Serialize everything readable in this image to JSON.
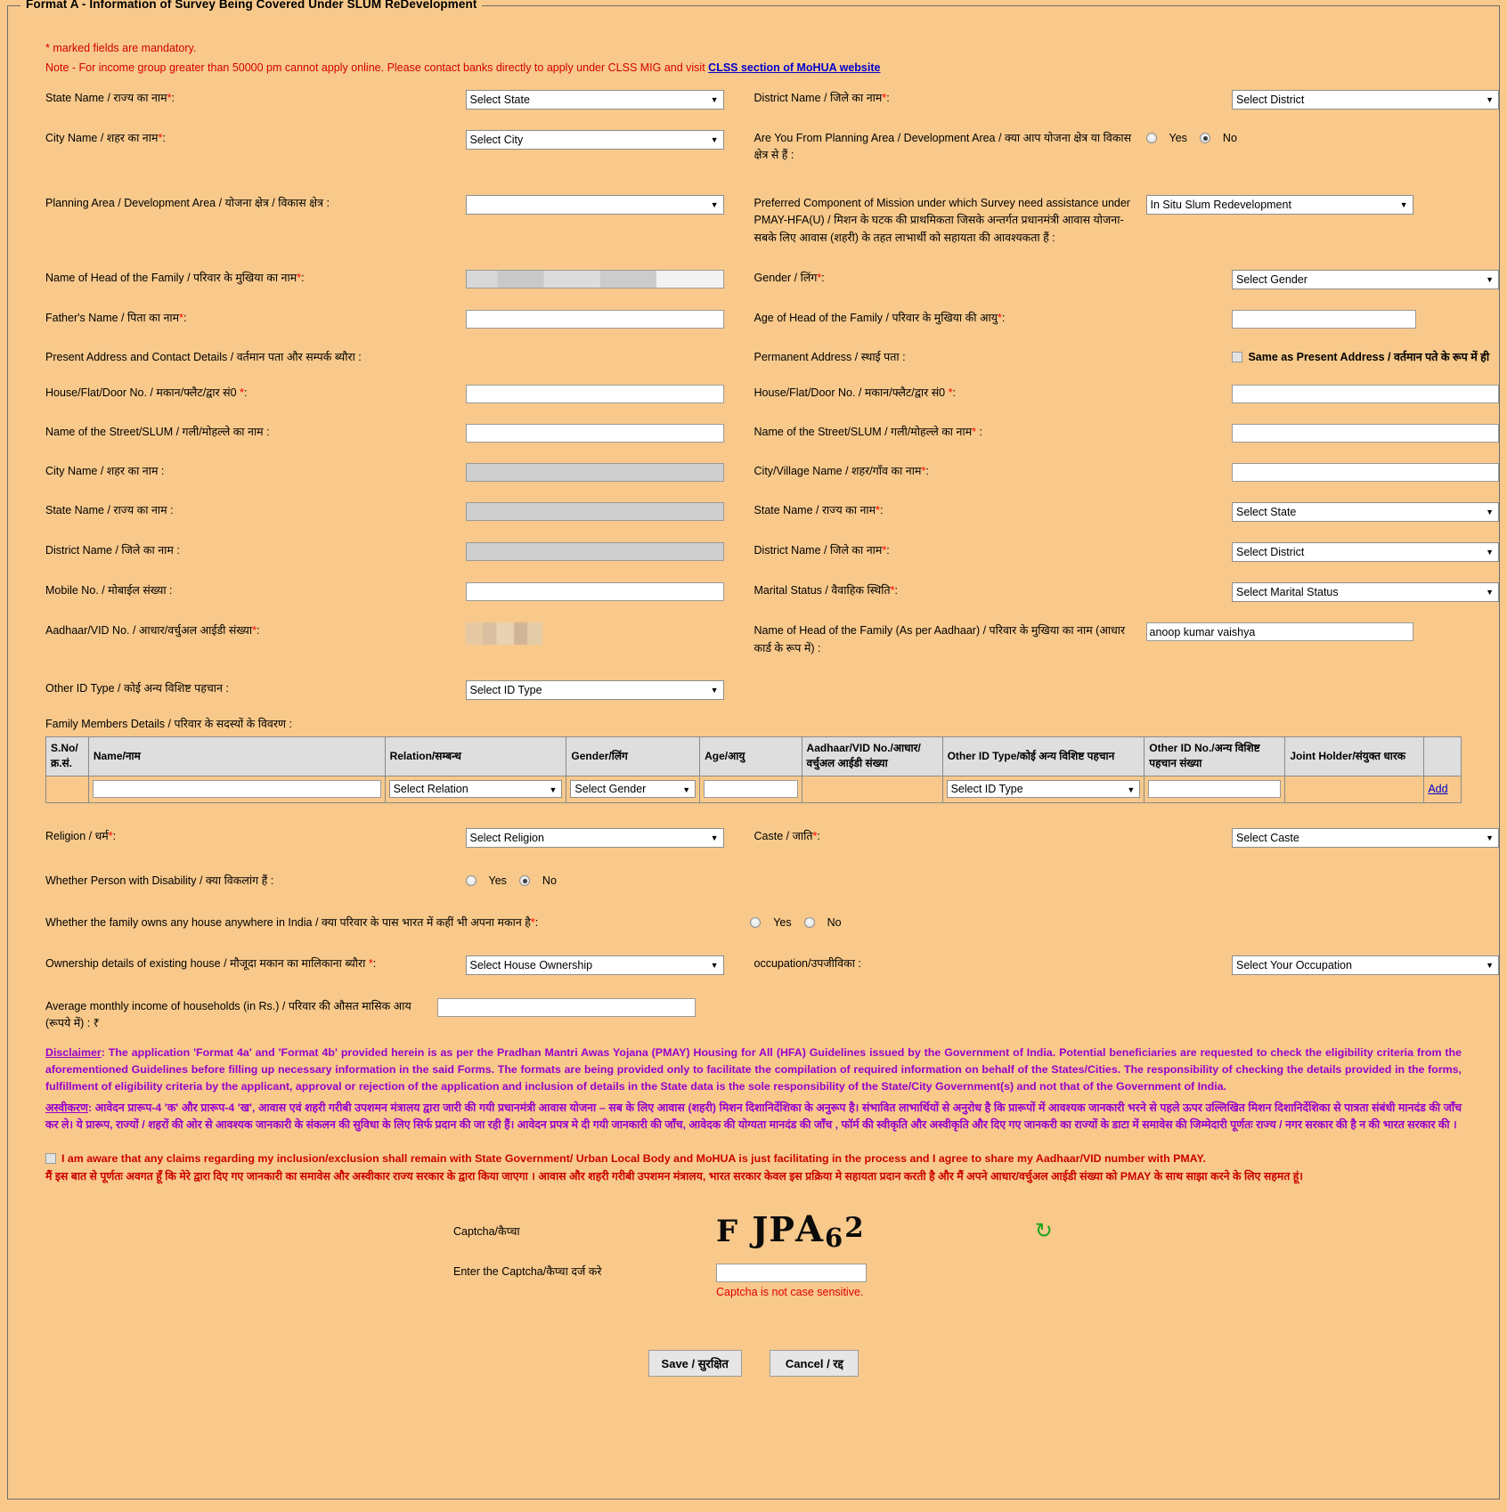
{
  "form": {
    "legend": "Format A - Information of Survey Being Covered Under SLUM ReDevelopment",
    "mandatory_note": "* marked fields are mandatory.",
    "income_note": "Note - For income group greater than 50000 pm cannot apply online. Please contact banks directly to apply under CLSS MIG and visit",
    "income_note_link": "CLSS section of MoHUA website"
  },
  "fields": {
    "state_name": {
      "label": "State Name / राज्य का नाम",
      "value": "Select State"
    },
    "district_name": {
      "label": "District Name / जिले का नाम",
      "value": "Select District"
    },
    "city_name": {
      "label": "City Name / शहर का नाम",
      "value": "Select City"
    },
    "planning_area_question": {
      "label": "Are You From Planning Area / Development Area / क्या आप योजना क्षेत्र या विकास क्षेत्र से हैं :",
      "yes": "Yes",
      "no": "No",
      "selected": "No"
    },
    "planning_area": {
      "label": "Planning Area / Development Area / योजना क्षेत्र / विकास क्षेत्र :",
      "value": ""
    },
    "preferred_component": {
      "label": "Preferred Component of Mission under which Survey need assistance under PMAY-HFA(U) / मिशन के घटक की प्राथमिकता जिसके अन्तर्गत प्रधानमंत्री आवास योजना-सबके लिए आवास (शहरी) के तहत लाभार्थी को सहायता की आवश्यकता हैं :",
      "value": "In Situ Slum Redevelopment"
    },
    "head_of_family": {
      "label": "Name of Head of the Family / परिवार के मुखिया का नाम",
      "value": ""
    },
    "gender": {
      "label": "Gender / लिंग",
      "value": "Select Gender"
    },
    "father_name": {
      "label": "Father's Name / पिता का नाम",
      "value": ""
    },
    "age_head": {
      "label": "Age of Head of the Family / परिवार के मुखिया की आयु",
      "value": ""
    },
    "present_address_heading": {
      "label": "Present Address and Contact Details / वर्तमान पता और सम्पर्क ब्यौरा :"
    },
    "permanent_address_heading": {
      "label": "Permanent Address / स्थाई पता :"
    },
    "same_as_present": {
      "label": "Same as Present Address / वर्तमान पते के रूप में ही",
      "checked": false
    },
    "p_house_no": {
      "label": "House/Flat/Door No. / मकान/फ्लैट/द्वार सं0",
      "value": ""
    },
    "perm_house_no": {
      "label": "House/Flat/Door No. / मकान/फ्लैट/द्वार सं0",
      "value": ""
    },
    "p_street": {
      "label": "Name of the Street/SLUM / गली/मोहल्ले का नाम :",
      "value": ""
    },
    "perm_street": {
      "label": "Name of the Street/SLUM / गली/मोहल्ले का नाम",
      "value": ""
    },
    "p_city": {
      "label": "City Name / शहर का नाम :",
      "value": ""
    },
    "perm_city_village": {
      "label": "City/Village Name / शहर/गाँव का नाम",
      "value": ""
    },
    "p_state": {
      "label": "State Name / राज्य का नाम :",
      "value": ""
    },
    "perm_state": {
      "label": "State Name / राज्य का नाम",
      "value": "Select State"
    },
    "p_district": {
      "label": "District Name / जिले का नाम :",
      "value": ""
    },
    "perm_district": {
      "label": "District Name / जिले का नाम",
      "value": "Select District"
    },
    "mobile_no": {
      "label": "Mobile No. / मोबाईल संख्या :",
      "value": ""
    },
    "marital_status": {
      "label": "Marital Status / वैवाहिक स्थिति",
      "value": "Select Marital Status"
    },
    "aadhaar_no": {
      "label": "Aadhaar/VID No. / आधार/वर्चुअल आईडी संख्या",
      "value": ""
    },
    "head_as_per_aadhaar": {
      "label": "Name of Head of the Family (As per Aadhaar) / परिवार के मुखिया का नाम (आधार कार्ड के रूप में) :",
      "value": "anoop kumar vaishya"
    },
    "other_id_type": {
      "label": "Other ID Type / कोई अन्य विशिष्ट पहचान :",
      "value": "Select ID Type"
    },
    "religion": {
      "label": "Religion / धर्म",
      "value": "Select Religion"
    },
    "caste": {
      "label": "Caste / जाति",
      "value": "Select Caste"
    },
    "disability": {
      "label": "Whether Person with Disability / क्या विकलांग हैं :",
      "yes": "Yes",
      "no": "No",
      "selected": "No"
    },
    "owns_house": {
      "label": "Whether the family owns any house anywhere in India / क्या परिवार के पास भारत में कहीं भी अपना मकान है",
      "yes": "Yes",
      "no": "No",
      "selected": ""
    },
    "ownership_details": {
      "label": "Ownership details of existing house / मौजूदा मकान का मालिकाना ब्यौरा",
      "value": "Select House Ownership"
    },
    "occupation": {
      "label": "occupation/उपजीविका  :",
      "value": "Select Your Occupation"
    },
    "avg_income": {
      "label": "Average monthly income of households (in Rs.) / परिवार की औसत मासिक आय (रूपये में) : ₹",
      "value": ""
    }
  },
  "family_table": {
    "heading": "Family Members Details / परिवार के सदस्यों के विवरण :",
    "columns": [
      "S.No/ क्र.सं.",
      "Name/नाम",
      "Relation/सम्बन्ध",
      "Gender/लिंग",
      "Age/आयु",
      "Aadhaar/VID No./आधार/ वर्चुअल आईडी संख्या",
      "Other ID Type/कोई अन्य विशिष्ट पहचान",
      "Other ID No./अन्य विशिष्ट पहचान संख्या",
      "Joint Holder/संयुक्त धारक"
    ],
    "row": {
      "sno": "",
      "name": "",
      "relation": "Select Relation",
      "gender": "Select Gender",
      "age": "",
      "aadhaar": "",
      "other_id_type": "Select ID Type",
      "other_id_no": "",
      "joint_holder": "",
      "add_label": "Add"
    }
  },
  "disclaimer": {
    "title": "Disclaimer",
    "en": ": The application 'Format 4a' and 'Format 4b' provided herein is as per the Pradhan Mantri Awas Yojana (PMAY) Housing for All (HFA) Guidelines issued by the Government of India. Potential beneficiaries are requested to check the eligibility criteria from the aforementioned Guidelines before filling up necessary information in the said Forms. The formats are being provided only to facilitate the compilation of required information on behalf of the States/Cities. The responsibility of checking the details provided in the forms, fulfillment of eligibility criteria by the applicant, approval or rejection of the application and inclusion of details in the State data is the sole responsibility of the State/City Government(s) and not that of the Government of India.",
    "hi_title": "अस्वीकरण",
    "hi": ": आवेदन प्रारूप-4 'क' और प्रारूप-4 'ख', आवास एवं शहरी गरीबी उपशमन मंत्रालय द्वारा जारी की गयी प्रधानमंत्री आवास योजना – सब के लिए आवास (शहरी) मिशन दिशानिर्देशिका के अनुरूप है। संभावित लाभार्थियों से अनुरोध है कि प्रारूपों में आवश्यक जानकारी भरने से पहले ऊपर उल्लिखित मिशन दिशानिर्देशिका से पात्रता संबंधी मानदंड की जाँच कर ले। ये प्रारूप, राज्यों / शहरों की ओर से आवश्यक जानकारी के संकलन की सुविधा के लिए सिर्फ प्रदान की जा रही हैं। आवेदन प्रपत्र मे दी गयी जानकारी की जाँच, आवेदक की योग्यता मानदंड की जाँच , फॉर्म की स्वीकृति और अस्वीकृति और दिए गए जानकरी का राज्यों के डाटा में समावेस की जिम्मेदारी पूर्णतः राज्य / नगर सरकार की है न की भारत सरकार की ।"
  },
  "consent": {
    "checked": false,
    "en": "I am aware that any claims regarding my inclusion/exclusion shall remain with State Government/ Urban Local Body and MoHUA is just facilitating in the process and I agree to share my Aadhaar/VID number with PMAY.",
    "hi": "मैं इस बात से पूर्णतः अवगत हूँ कि मेरे द्वारा दिए गए जानकारी का समावेस और अस्वीकार राज्य सरकार के द्वारा किया जाएगा । आवास और शहरी गरीबी उपशमन मंत्रालय, भारत सरकार केवल इस प्रक्रिया मे सहायता प्रदान करती है और मैं अपने आधार/वर्चुअल आईडी संख्या को PMAY के साथ साझा करने के लिए सहमत हूं।"
  },
  "captcha": {
    "label": "Captcha/कैप्चा",
    "code": "FJPA62",
    "enter_label": "Enter the Captcha/कैप्चा दर्ज करे",
    "value": "",
    "note": "Captcha is not case sensitive.",
    "refresh_icon": "refresh-icon"
  },
  "buttons": {
    "save": "Save / सुरक्षित",
    "cancel": "Cancel / रद्द"
  },
  "colors": {
    "page_bg": "#F8C98B",
    "required": "#ff0000",
    "note": "#d40000",
    "link": "#0000cc",
    "disclaimer": "#9900cc",
    "consent": "#cc0000"
  }
}
